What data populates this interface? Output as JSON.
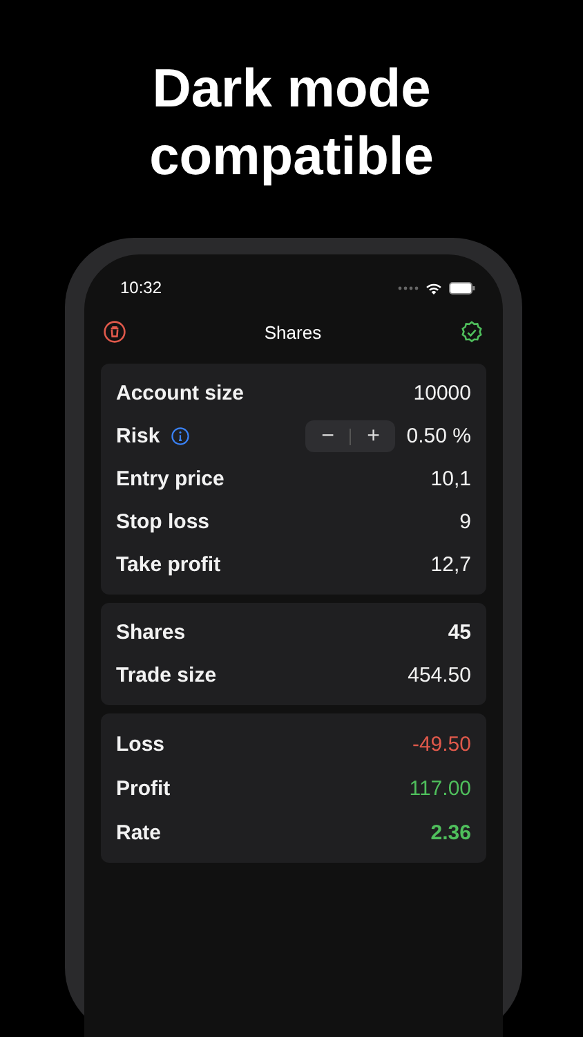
{
  "headline": [
    "Dark mode",
    "compatible"
  ],
  "status_bar": {
    "time": "10:32"
  },
  "nav": {
    "title": "Shares"
  },
  "sections": [
    {
      "rows": [
        {
          "kind": "plain",
          "label": "Account size",
          "value": "10000",
          "color": "#f2f2f2",
          "bold": false
        },
        {
          "kind": "stepper",
          "label": "Risk",
          "value": "0.50 %",
          "color": "#f2f2f2",
          "bold": false,
          "minus": "−",
          "plus": "+"
        },
        {
          "kind": "plain",
          "label": "Entry price",
          "value": "10,1",
          "color": "#f2f2f2",
          "bold": false
        },
        {
          "kind": "plain",
          "label": "Stop loss",
          "value": "9",
          "color": "#f2f2f2",
          "bold": false
        },
        {
          "kind": "plain",
          "label": "Take profit",
          "value": "12,7",
          "color": "#f2f2f2",
          "bold": false
        }
      ]
    },
    {
      "rows": [
        {
          "kind": "plain",
          "label": "Shares",
          "value": "45",
          "color": "#f2f2f2",
          "bold": true
        },
        {
          "kind": "plain",
          "label": "Trade size",
          "value": "454.50",
          "color": "#f2f2f2",
          "bold": false
        }
      ]
    },
    {
      "rows": [
        {
          "kind": "plain",
          "label": "Loss",
          "value": "-49.50",
          "color": "#e0594b",
          "bold": false
        },
        {
          "kind": "plain",
          "label": "Profit",
          "value": "117.00",
          "color": "#4fbf5c",
          "bold": false
        },
        {
          "kind": "plain",
          "label": "Rate",
          "value": "2.36",
          "color": "#4fbf5c",
          "bold": true
        }
      ]
    }
  ]
}
